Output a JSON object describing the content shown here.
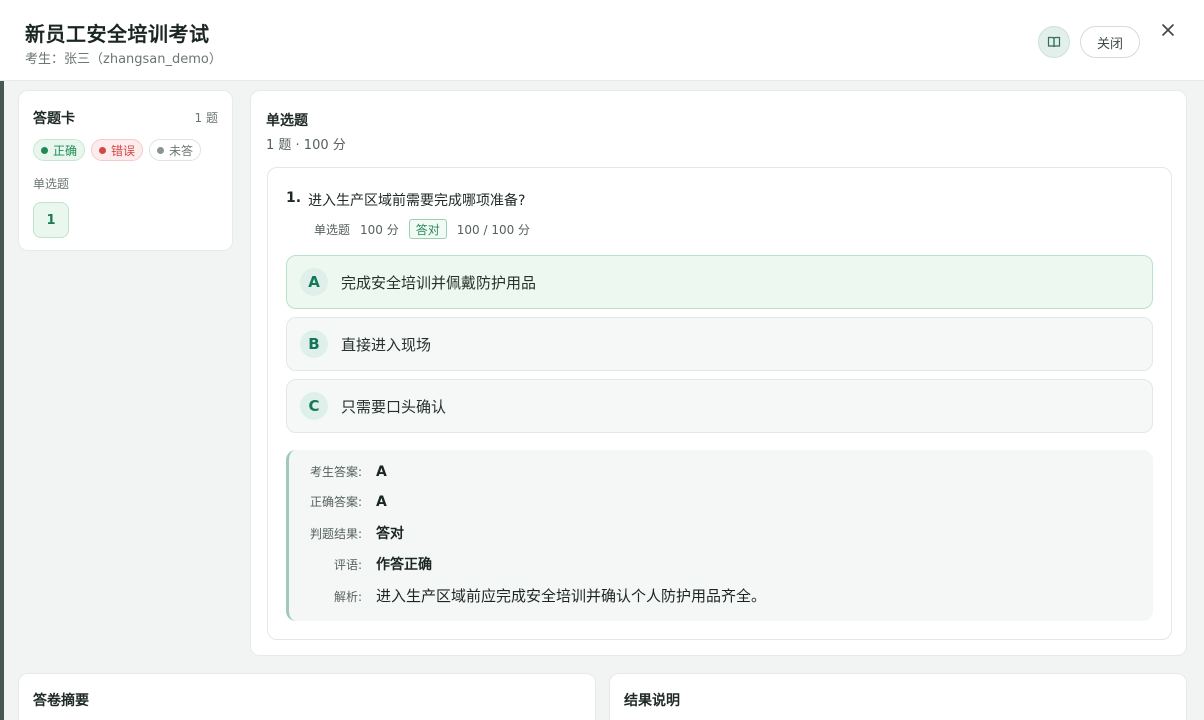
{
  "header": {
    "title": "新员工安全培训考试",
    "candidate_label": "考生：",
    "candidate_name": "张三（zhangsan_demo）",
    "close_label": "关闭"
  },
  "answer_card": {
    "title": "答题卡",
    "count": "1 题",
    "legend": {
      "correct": "正确",
      "wrong": "错误",
      "unanswered": "未答"
    },
    "group_label": "单选题",
    "questions": [
      "1"
    ]
  },
  "section": {
    "title": "单选题",
    "meta": "1 题 · 100 分"
  },
  "question": {
    "number": "1.",
    "text": "进入生产区域前需要完成哪项准备?",
    "type": "单选题",
    "points": "100 分",
    "result_tag": "答对",
    "score": "100 / 100 分",
    "options": [
      {
        "letter": "A",
        "text": "完成安全培训并佩戴防护用品"
      },
      {
        "letter": "B",
        "text": "直接进入现场"
      },
      {
        "letter": "C",
        "text": "只需要口头确认"
      }
    ]
  },
  "answer_detail": {
    "student_answer_label": "考生答案:",
    "student_answer": "A",
    "correct_answer_label": "正确答案:",
    "correct_answer": "A",
    "judgement_label": "判题结果:",
    "judgement": "答对",
    "comment_label": "评语:",
    "comment": "作答正确",
    "analysis_label": "解析:",
    "analysis": "进入生产区域前应完成安全培训并确认个人防护用品齐全。"
  },
  "bottom": {
    "summary_title": "答卷摘要",
    "result_title": "结果说明"
  },
  "colors": {
    "accent": "#15765a",
    "correct": "#1f8a55",
    "wrong": "#d24848"
  }
}
